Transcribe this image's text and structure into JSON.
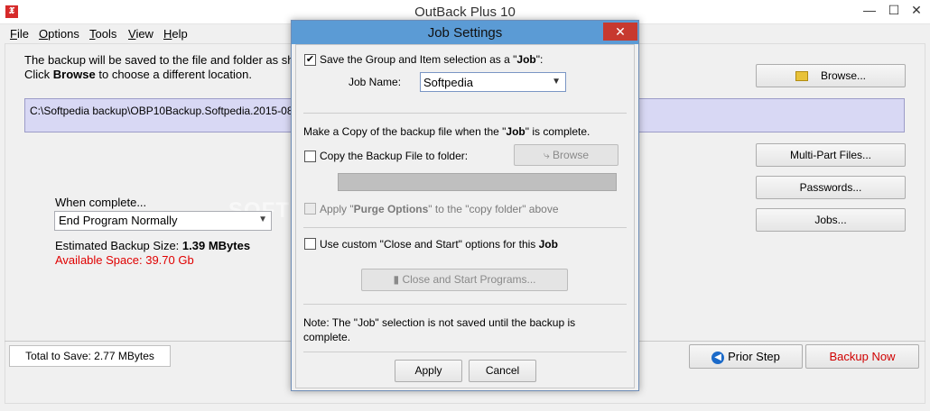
{
  "app": {
    "title": "OutBack Plus 10",
    "icon_glyph": "𝖃",
    "controls": {
      "minimize": "—",
      "maximize": "☐",
      "close": "✕"
    }
  },
  "menu": {
    "items": [
      {
        "label": "File",
        "underline": "F",
        "rest": "ile"
      },
      {
        "label": "Options",
        "underline": "O",
        "rest": "ptions"
      },
      {
        "label": "Tools",
        "underline": "T",
        "rest": "ools"
      },
      {
        "label": "View",
        "underline": "V",
        "rest": "iew"
      },
      {
        "label": "Help",
        "underline": "H",
        "rest": "elp"
      }
    ]
  },
  "main": {
    "desc_line1": "The backup will be saved to the file and folder as show",
    "desc_line2_prefix": "Click ",
    "desc_line2_bold": "Browse",
    "desc_line2_suffix": " to choose a different location.",
    "browse_label": "Browse...",
    "path": "C:\\Softpedia backup\\OBP10Backup.Softpedia.2015-08-15.1",
    "multipart_label": "Multi-Part Files...",
    "passwords_label": "Passwords...",
    "jobs_label": "Jobs...",
    "when_complete_label": "When complete...",
    "when_complete_value": "End Program Normally",
    "est_size_prefix": "Estimated Backup Size: ",
    "est_size_value": "1.39 MBytes",
    "available_space": "Available Space: 39.70 Gb",
    "total_to_save": "Total to Save: 2.77 MBytes",
    "prior_step_label": "Prior Step",
    "backup_now_label": "Backup Now",
    "watermark": "SOFTPEDIA"
  },
  "dialog": {
    "title": "Job Settings",
    "close_glyph": "✕",
    "save_selection_prefix": "Save the Group and Item selection as a \"",
    "save_selection_bold": "Job",
    "save_selection_suffix": "\":",
    "save_selection_checked": true,
    "job_name_label": "Job Name:",
    "job_name_value": "Softpedia",
    "copy_heading_prefix": "Make a Copy of the backup file when the \"",
    "copy_heading_bold": "Job",
    "copy_heading_suffix": "\" is complete.",
    "copy_to_folder_label": "Copy the Backup File to folder:",
    "copy_to_folder_checked": false,
    "browse_label": "Browse",
    "apply_purge_prefix": "Apply \"",
    "apply_purge_bold": "Purge Options",
    "apply_purge_suffix": "\" to the \"copy folder\" above",
    "custom_close_prefix": "Use custom \"Close and Start\" options for this ",
    "custom_close_bold": "Job",
    "custom_close_checked": false,
    "close_start_label": "Close and Start Programs...",
    "note_line1": "Note: The \"Job\" selection is not saved until the backup is",
    "note_line2": "complete.",
    "apply_label": "Apply",
    "cancel_label": "Cancel"
  },
  "colors": {
    "dialog_title_bg": "#5b9bd5",
    "path_bg": "#d8d8f4",
    "warning_red": "#e00000"
  }
}
